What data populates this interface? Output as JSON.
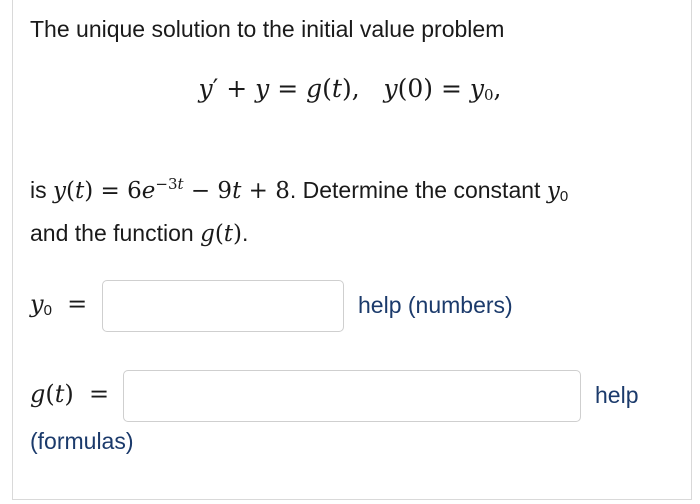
{
  "problem": {
    "intro_text": "The unique solution to the initial value problem",
    "sentence_is": "is",
    "sentence_mid": ". Determine the constant",
    "sentence_end": "and the function",
    "sentence_period": "."
  },
  "answers": {
    "y0_label": "y0 =",
    "y0_value": "",
    "y0_help": "help (numbers)",
    "g_label": "g(t) =",
    "g_value": "",
    "g_help": "help",
    "g_help_sub": "(formulas)"
  }
}
